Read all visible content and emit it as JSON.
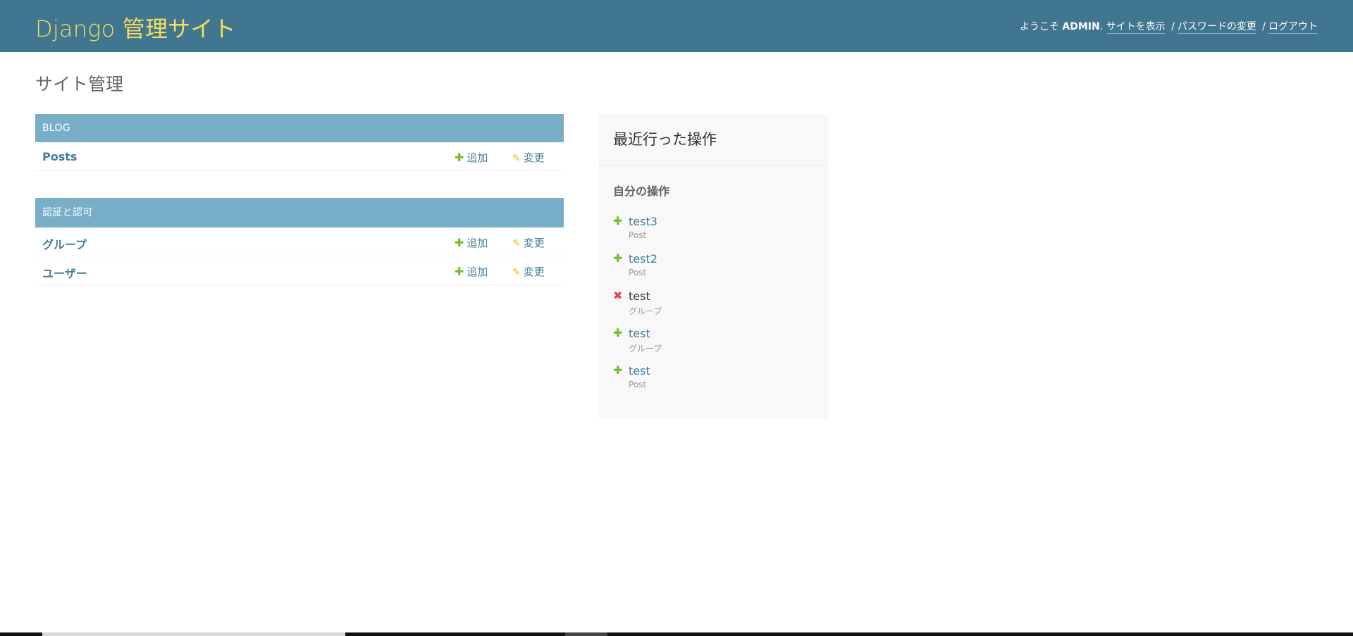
{
  "header": {
    "branding": "Django 管理サイト",
    "welcome": "ようこそ",
    "username": "ADMIN",
    "links": [
      {
        "label": "サイトを表示"
      },
      {
        "label": "パスワードの変更"
      },
      {
        "label": "ログアウト"
      }
    ]
  },
  "page_title": "サイト管理",
  "modules": [
    {
      "caption": "BLOG",
      "rows": [
        {
          "name": "Posts",
          "add": "追加",
          "change": "変更"
        }
      ]
    },
    {
      "caption": "認証と認可",
      "rows": [
        {
          "name": "グループ",
          "add": "追加",
          "change": "変更"
        },
        {
          "name": "ユーザー",
          "add": "追加",
          "change": "変更"
        }
      ]
    }
  ],
  "recent_actions": {
    "title": "最近行った操作",
    "subtitle": "自分の操作",
    "items": [
      {
        "action": "add",
        "icon": "plus-icon",
        "name": "test3",
        "type": "Post"
      },
      {
        "action": "add",
        "icon": "plus-icon",
        "name": "test2",
        "type": "Post"
      },
      {
        "action": "delete",
        "icon": "delete-x-icon",
        "name": "test",
        "type": "グループ"
      },
      {
        "action": "add",
        "icon": "plus-icon",
        "name": "test",
        "type": "グループ"
      },
      {
        "action": "add",
        "icon": "plus-icon",
        "name": "test",
        "type": "Post"
      }
    ]
  },
  "colors": {
    "header_bg": "#417690",
    "branding": "#f5dd5d",
    "caption_bg": "#79aec8",
    "link": "#447e9b",
    "add_icon": "#70bf2b",
    "change_icon": "#efb80b",
    "delete_icon": "#dd4646"
  }
}
